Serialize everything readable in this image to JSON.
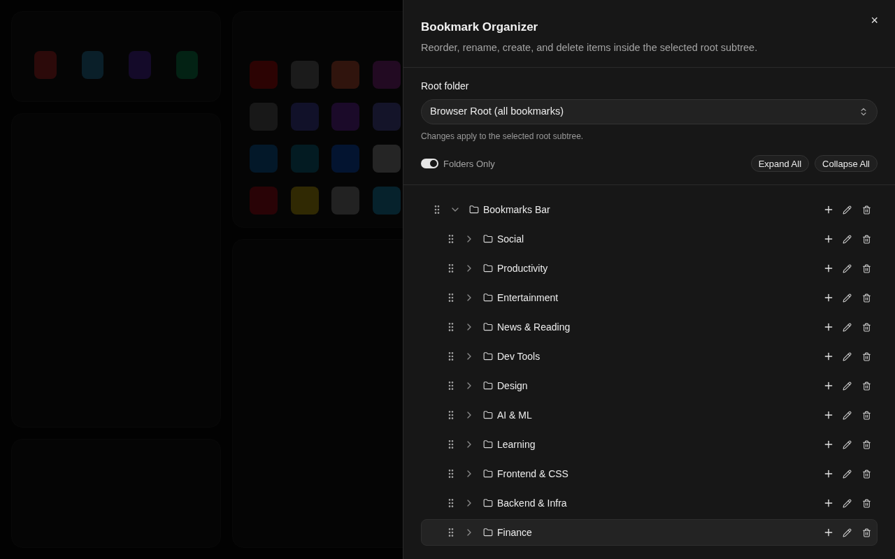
{
  "dialog": {
    "title": "Bookmark Organizer",
    "description": "Reorder, rename, create, and delete items inside the selected root subtree.",
    "close_label": "×"
  },
  "root_folder": {
    "label": "Root folder",
    "value": "Browser Root (all bookmarks)",
    "hint": "Changes apply to the selected root subtree."
  },
  "folders_only": {
    "label": "Folders Only",
    "on": true
  },
  "buttons": [
    "Expand All",
    "Collapse All"
  ],
  "tree": [
    {
      "name": "Bookmarks Bar",
      "expanded": true,
      "selected": false,
      "children": [
        {
          "name": "Social",
          "expanded": false,
          "selected": false
        },
        {
          "name": "Productivity",
          "expanded": false,
          "selected": false
        },
        {
          "name": "Entertainment",
          "expanded": false,
          "selected": false
        },
        {
          "name": "News & Reading",
          "expanded": false,
          "selected": false
        },
        {
          "name": "Dev Tools",
          "expanded": false,
          "selected": false
        },
        {
          "name": "Design",
          "expanded": false,
          "selected": false
        },
        {
          "name": "AI & ML",
          "expanded": false,
          "selected": false
        },
        {
          "name": "Learning",
          "expanded": false,
          "selected": false
        },
        {
          "name": "Frontend & CSS",
          "expanded": false,
          "selected": false
        },
        {
          "name": "Backend & Infra",
          "expanded": false,
          "selected": false
        },
        {
          "name": "Finance",
          "expanded": false,
          "selected": true
        }
      ]
    }
  ]
}
